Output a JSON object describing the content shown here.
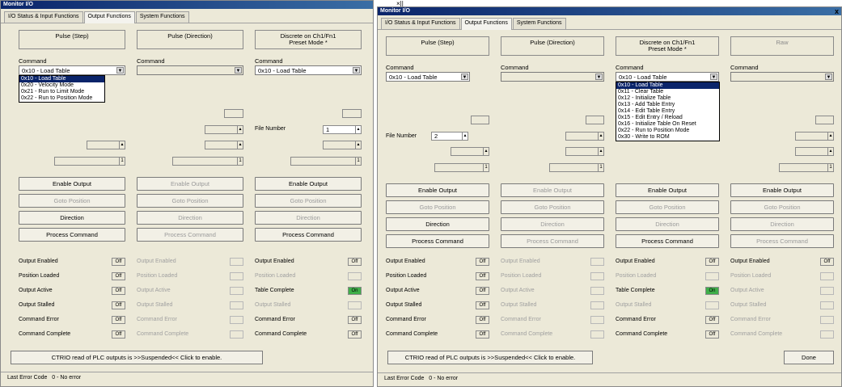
{
  "w1": {
    "title": "Monitor I/O",
    "tabs": [
      "I/O Status & Input Functions",
      "Output Functions",
      "System Functions"
    ],
    "cols": [
      {
        "mode": "Pulse (Step)",
        "command_label": "Command",
        "command": "0x10 - Load Table",
        "list": [
          "0x10 - Load Table",
          "0x20 - Velocity Mode",
          "0x21 - Run to Limit Mode",
          "0x22 - Run to Position Mode"
        ],
        "buttons": [
          "Enable Output",
          "Goto Position",
          "Direction",
          "Process Command"
        ],
        "statuses": [
          "Output Enabled",
          "Position Loaded",
          "Output Active",
          "Output Stalled",
          "Command Error",
          "Command Complete"
        ],
        "inds": [
          "Off",
          "Off",
          "Off",
          "Off",
          "Off",
          "Off"
        ]
      },
      {
        "mode": "Pulse (Direction)",
        "command_label": "Command",
        "command": "",
        "buttons": [
          "Enable Output",
          "Goto Position",
          "Direction",
          "Process Command"
        ],
        "statuses": [
          "Output Enabled",
          "Position Loaded",
          "Output Active",
          "Output Stalled",
          "Command Error",
          "Command Complete"
        ]
      },
      {
        "mode": "Discrete on Ch1/Fn1\nPreset Mode *",
        "command_label": "Command",
        "command": "0x10 - Load Table",
        "file_number_label": "File Number",
        "file_number": "1",
        "buttons": [
          "Enable Output",
          "Goto Position",
          "Direction",
          "Process Command"
        ],
        "statuses": [
          "Output Enabled",
          "Position Loaded",
          "Table Complete",
          "Output Stalled",
          "Command Error",
          "Command Complete"
        ],
        "inds": [
          "Off",
          "",
          "On",
          "",
          "Off",
          "Off"
        ]
      }
    ],
    "suspend_btn": "CTRIO read of PLC outputs is >>Suspended<< Click to enable.",
    "last_error_label": "Last Error Code",
    "last_error": "0 - No error"
  },
  "w2": {
    "title": "Monitor I/O",
    "close": "x",
    "tabs": [
      "I/O Status & Input Functions",
      "Output Functions",
      "System Functions"
    ],
    "cols": [
      {
        "mode": "Pulse (Step)",
        "command_label": "Command",
        "command": "0x10 - Load Table",
        "file_number_label": "File Number",
        "file_number": "2",
        "buttons": [
          "Enable Output",
          "Goto Position",
          "Direction",
          "Process Command"
        ],
        "statuses": [
          "Output Enabled",
          "Position Loaded",
          "Output Active",
          "Output Stalled",
          "Command Error",
          "Command Complete"
        ],
        "inds": [
          "Off",
          "Off",
          "Off",
          "Off",
          "Off",
          "Off"
        ]
      },
      {
        "mode": "Pulse (Direction)",
        "command_label": "Command",
        "command": "",
        "buttons": [
          "Enable Output",
          "Goto Position",
          "Direction",
          "Process Command"
        ],
        "statuses": [
          "Output Enabled",
          "Position Loaded",
          "Output Active",
          "Output Stalled",
          "Command Error",
          "Command Complete"
        ]
      },
      {
        "mode": "Discrete on Ch1/Fn1\nPreset Mode *",
        "command_label": "Command",
        "command": "0x10 - Load Table",
        "list": [
          "0x10 - Load Table",
          "0x11 - Clear Table",
          "0x12 - Initialize Table",
          "0x13 - Add Table Entry",
          "0x14 - Edit Table Entry",
          "0x15 - Edit Entry / Reload",
          "0x16 - Initialize Table On Reset",
          "0x22 - Run to Position Mode",
          "0x30 - Write to ROM"
        ],
        "buttons": [
          "Enable Output",
          "Goto Position",
          "Direction",
          "Process Command"
        ],
        "statuses": [
          "Output Enabled",
          "Position Loaded",
          "Table Complete",
          "Output Stalled",
          "Command Error",
          "Command Complete"
        ],
        "inds": [
          "Off",
          "",
          "On",
          "",
          "Off",
          "Off"
        ]
      },
      {
        "mode": "Raw",
        "command_label": "Command",
        "command": "",
        "buttons": [
          "Enable Output",
          "Goto Position",
          "Direction",
          "Process Command"
        ],
        "statuses": [
          "Output Enabled",
          "Position Loaded",
          "Output Active",
          "Output Stalled",
          "Command Error",
          "Command Complete"
        ],
        "inds": [
          "Off",
          "",
          "",
          "",
          "",
          ""
        ]
      }
    ],
    "suspend_btn": "CTRIO read of PLC outputs is >>Suspended<< Click to enable.",
    "done_btn": "Done",
    "last_error_label": "Last Error Code",
    "last_error": "0 - No error"
  },
  "stray": "×||"
}
